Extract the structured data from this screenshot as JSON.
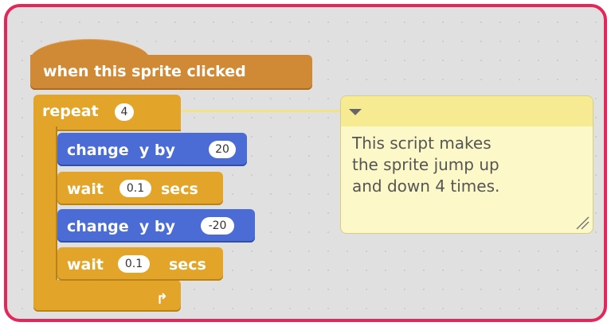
{
  "script": {
    "hat": {
      "label": "when this sprite clicked"
    },
    "repeat": {
      "label": "repeat",
      "count": "4"
    },
    "blocks": [
      {
        "kind": "motion",
        "label": "change  y by",
        "value": "20"
      },
      {
        "kind": "control",
        "label": "wait",
        "value": "0.1",
        "suffix": "secs"
      },
      {
        "kind": "motion",
        "label": "change  y by",
        "value": "-20"
      },
      {
        "kind": "control",
        "label": "wait",
        "value": "0.1",
        "suffix": "secs"
      }
    ],
    "loop_arrow_icon": "loop-arrow-icon"
  },
  "comment": {
    "text": "This script makes\nthe sprite jump up\nand down 4 times."
  },
  "colors": {
    "frame_border": "#e3275a",
    "events": "#d08a35",
    "control": "#e2a529",
    "motion": "#4a6cd4",
    "comment_bg": "#fdf8c8",
    "comment_bar": "#f6ea92"
  }
}
